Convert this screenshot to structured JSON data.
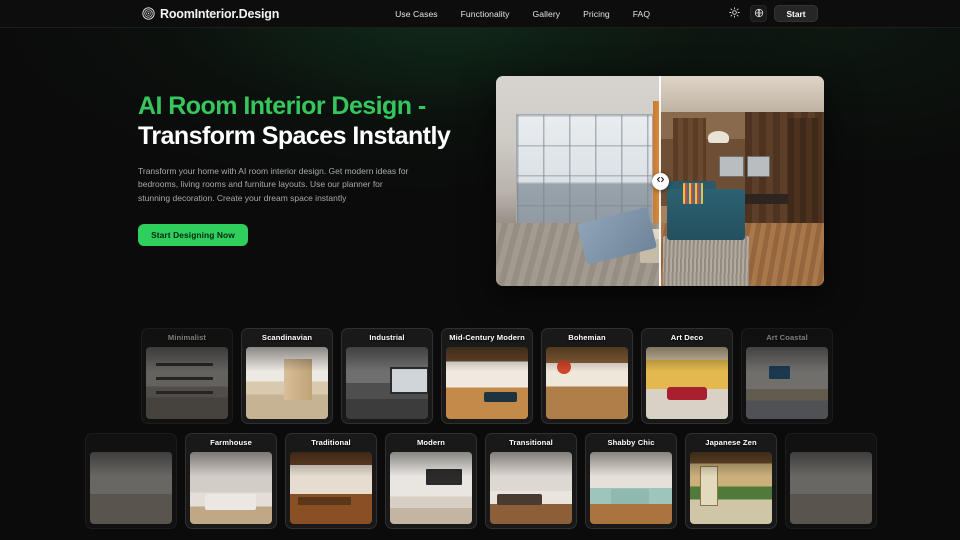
{
  "header": {
    "brand": "RoomInterior.Design",
    "brand_icon": "concentric-circles-logo",
    "nav": [
      {
        "label": "Use Cases"
      },
      {
        "label": "Functionality"
      },
      {
        "label": "Gallery"
      },
      {
        "label": "Pricing"
      },
      {
        "label": "FAQ"
      }
    ],
    "theme_toggle_icon": "sun-icon",
    "language_icon": "globe-icon",
    "start_label": "Start"
  },
  "hero": {
    "headline_accent": "AI Room Interior Design -",
    "headline_plain": " Transform Spaces Instantly",
    "subcopy": "Transform your home with AI room interior design. Get modern ideas for bedrooms, living rooms and furniture layouts. Use our planner for stunning decoration. Create your dream space instantly",
    "cta_label": "Start Designing Now",
    "compare": {
      "handle_icon": "left-right-arrows-icon",
      "before_alt": "before-room-photo",
      "after_alt": "after-room-photo"
    }
  },
  "styles": {
    "row1": [
      {
        "label": "Minimalist",
        "thumb": "t-minimalist"
      },
      {
        "label": "Scandinavian",
        "thumb": "t-scandinavian"
      },
      {
        "label": "Industrial",
        "thumb": "t-industrial"
      },
      {
        "label": "Mid-Century Modern",
        "thumb": "t-midcentury"
      },
      {
        "label": "Bohemian",
        "thumb": "t-bohemian"
      },
      {
        "label": "Art Deco",
        "thumb": "t-artdeco"
      },
      {
        "label": "Art Coastal",
        "thumb": "t-artcoastal"
      }
    ],
    "row2": [
      {
        "label": "",
        "thumb": "t-extra"
      },
      {
        "label": "Farmhouse",
        "thumb": "t-farmhouse"
      },
      {
        "label": "Traditional",
        "thumb": "t-traditional"
      },
      {
        "label": "Modern",
        "thumb": "t-modern"
      },
      {
        "label": "Transitional",
        "thumb": "t-transitional"
      },
      {
        "label": "Shabby Chic",
        "thumb": "t-shabbychic"
      },
      {
        "label": "Japanese Zen",
        "thumb": "t-japanesezen"
      },
      {
        "label": "",
        "thumb": "t-extra"
      }
    ]
  },
  "colors": {
    "background": "#0b0b0b",
    "accent_green": "#35c65e",
    "cta_green": "#2fcf5d",
    "header_bg": "#0d0d0d",
    "text_primary": "#ffffff",
    "text_muted": "#a9a9a9"
  }
}
